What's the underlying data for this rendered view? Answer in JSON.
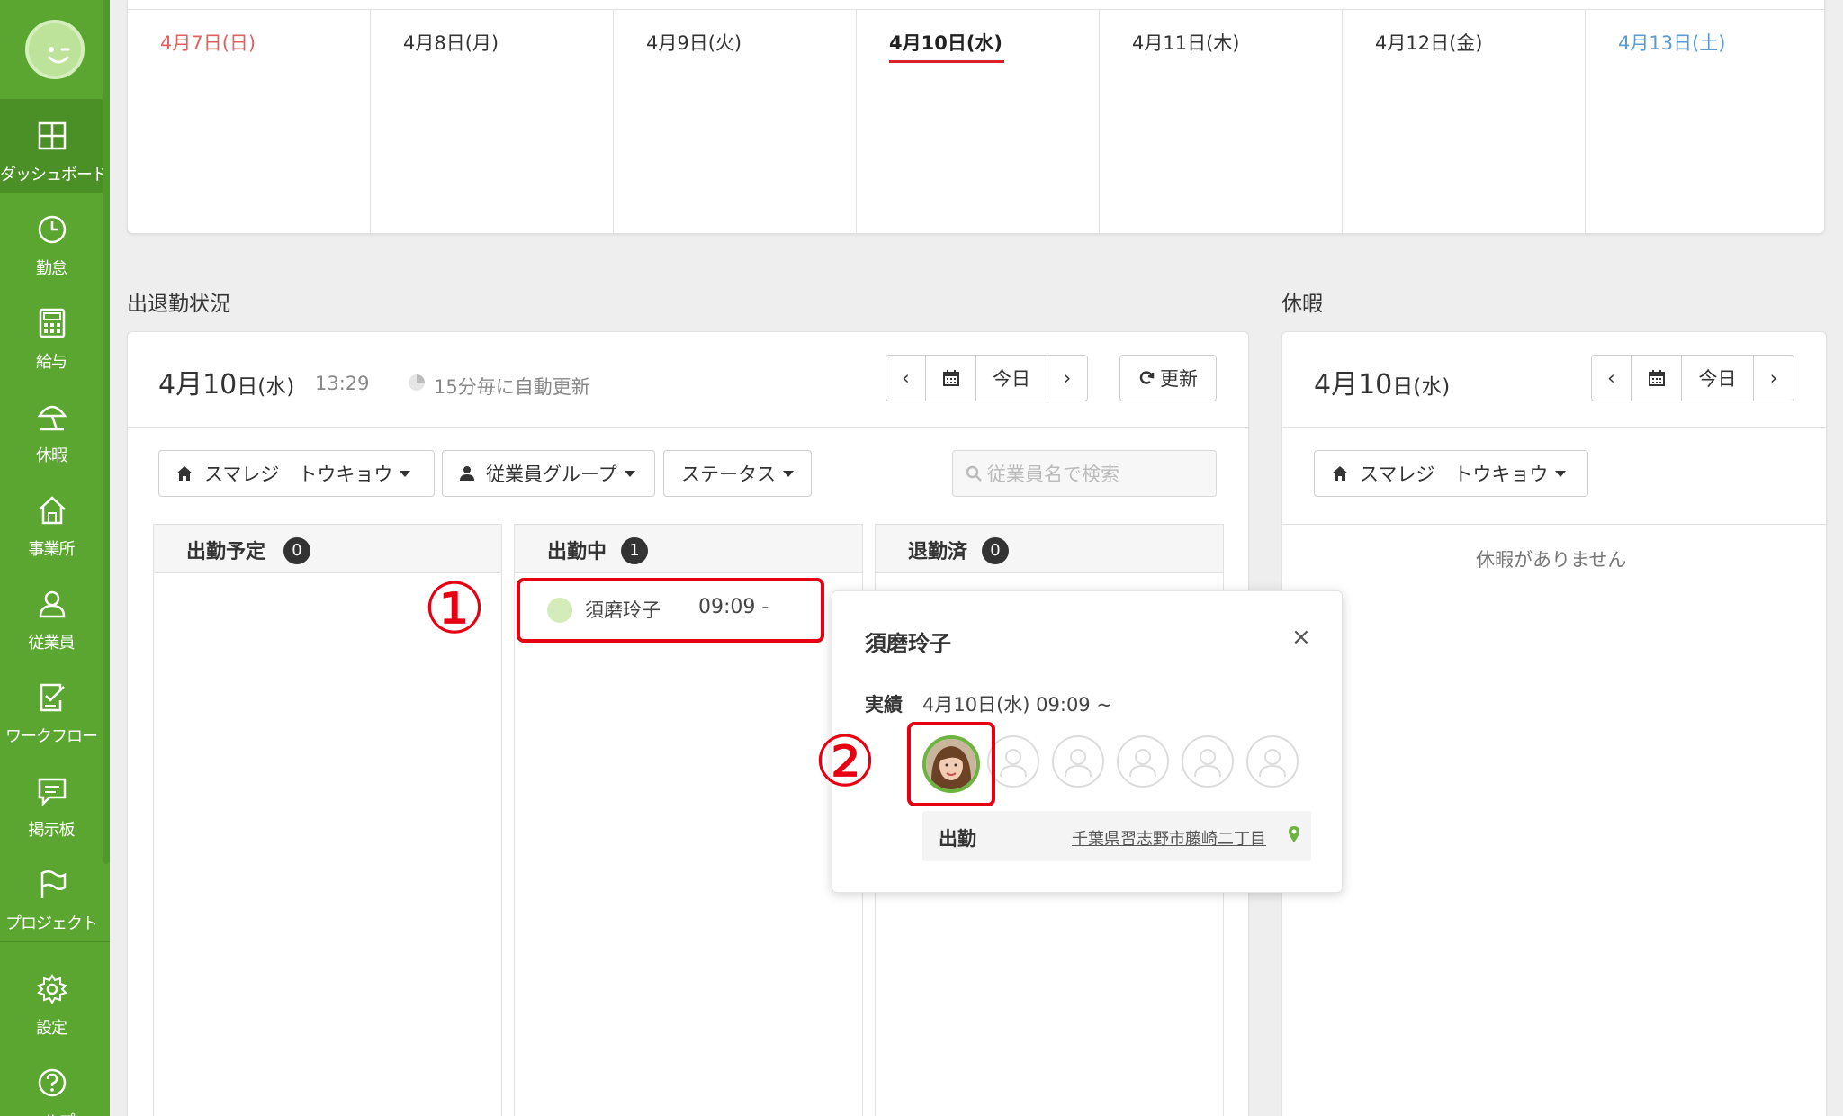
{
  "sidebar": {
    "items": [
      {
        "label": "ダッシュボード",
        "icon": "dashboard-icon",
        "active": true
      },
      {
        "label": "勤怠",
        "icon": "clock-icon"
      },
      {
        "label": "給与",
        "icon": "calculator-icon"
      },
      {
        "label": "休暇",
        "icon": "beach-umbrella-icon"
      },
      {
        "label": "事業所",
        "icon": "home-icon"
      },
      {
        "label": "従業員",
        "icon": "user-icon"
      },
      {
        "label": "ワークフロー",
        "icon": "checklist-icon"
      },
      {
        "label": "掲示板",
        "icon": "chat-icon"
      },
      {
        "label": "プロジェクト",
        "icon": "flag-icon"
      },
      {
        "label": "設定",
        "icon": "gear-icon"
      },
      {
        "label": "ヘルプ",
        "icon": "help-icon"
      }
    ]
  },
  "week": {
    "days": [
      "4月7日(日)",
      "4月8日(月)",
      "4月9日(火)",
      "4月10日(水)",
      "4月11日(木)",
      "4月12日(金)",
      "4月13日(土)"
    ]
  },
  "attendance": {
    "section_title": "出退勤状況",
    "date_num": "4月10",
    "date_suffix": "日(水)",
    "time": "13:29",
    "auto_refresh": "15分毎に自動更新",
    "today_button": "今日",
    "refresh_button": "更新",
    "filters": {
      "store": "スマレジ　トウキョウ",
      "group": "従業員グループ",
      "status": "ステータス",
      "search_placeholder": "従業員名で検索"
    },
    "columns": [
      {
        "title": "出勤予定",
        "count": "0"
      },
      {
        "title": "出勤中",
        "count": "1"
      },
      {
        "title": "退勤済",
        "count": "0"
      }
    ],
    "employee": {
      "name": "須磨玲子",
      "time": "09:09 -"
    }
  },
  "annotations": {
    "one": "①",
    "two": "②"
  },
  "popup": {
    "name": "須磨玲子",
    "close": "×",
    "record_label": "実績",
    "record_value": "4月10日(水) 09:09 ~",
    "row_label": "出勤",
    "address": "千葉県習志野市藤崎二丁目"
  },
  "vacation": {
    "section_title": "休暇",
    "date_num": "4月10",
    "date_suffix": "日(水)",
    "today_button": "今日",
    "store": "スマレジ　トウキョウ",
    "empty_text": "休暇がありません"
  },
  "colors": {
    "sidebar": "#5aa631",
    "sidebar_active": "#4b9026",
    "sunday": "#e0615f",
    "saturday": "#5b9bd1",
    "today_underline": "#d9202b",
    "annotation_red": "#e60012"
  }
}
